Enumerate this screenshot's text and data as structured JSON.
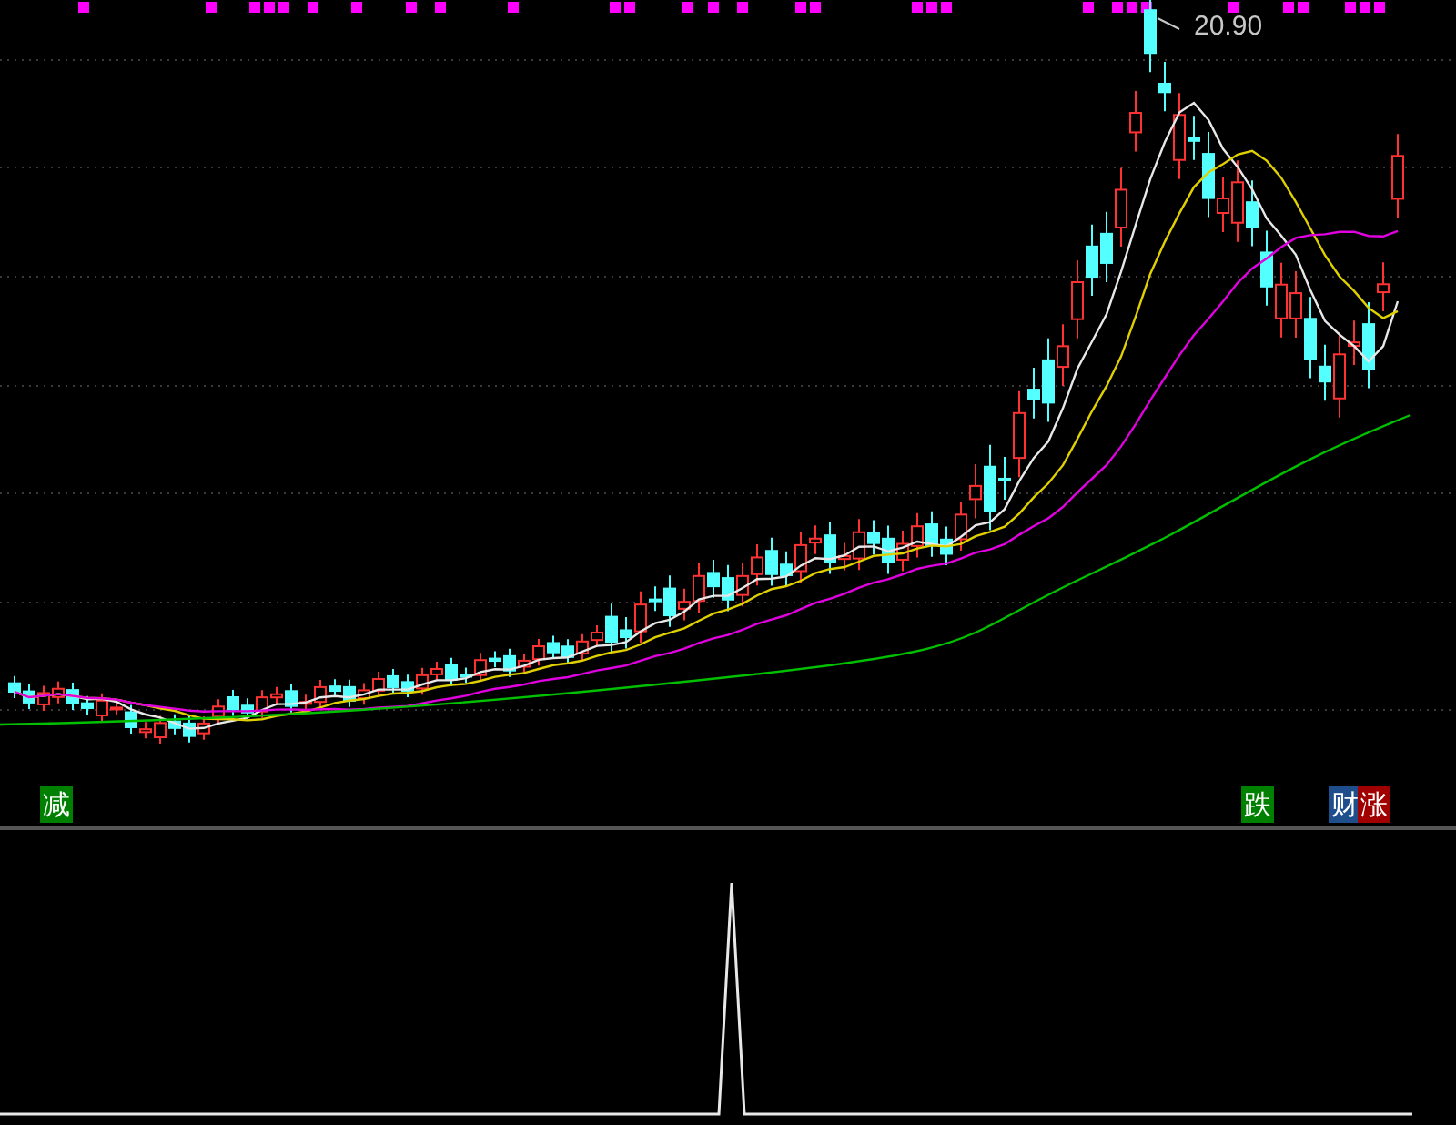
{
  "main_chart": {
    "peak_label": "20.90",
    "signals": [
      {
        "label": "减",
        "color": "#008000"
      },
      {
        "label": "跌",
        "color": "#008000"
      },
      {
        "label": "财",
        "color": "#1e4e8c"
      },
      {
        "label": "涨",
        "color": "#a00000"
      }
    ]
  }
}
